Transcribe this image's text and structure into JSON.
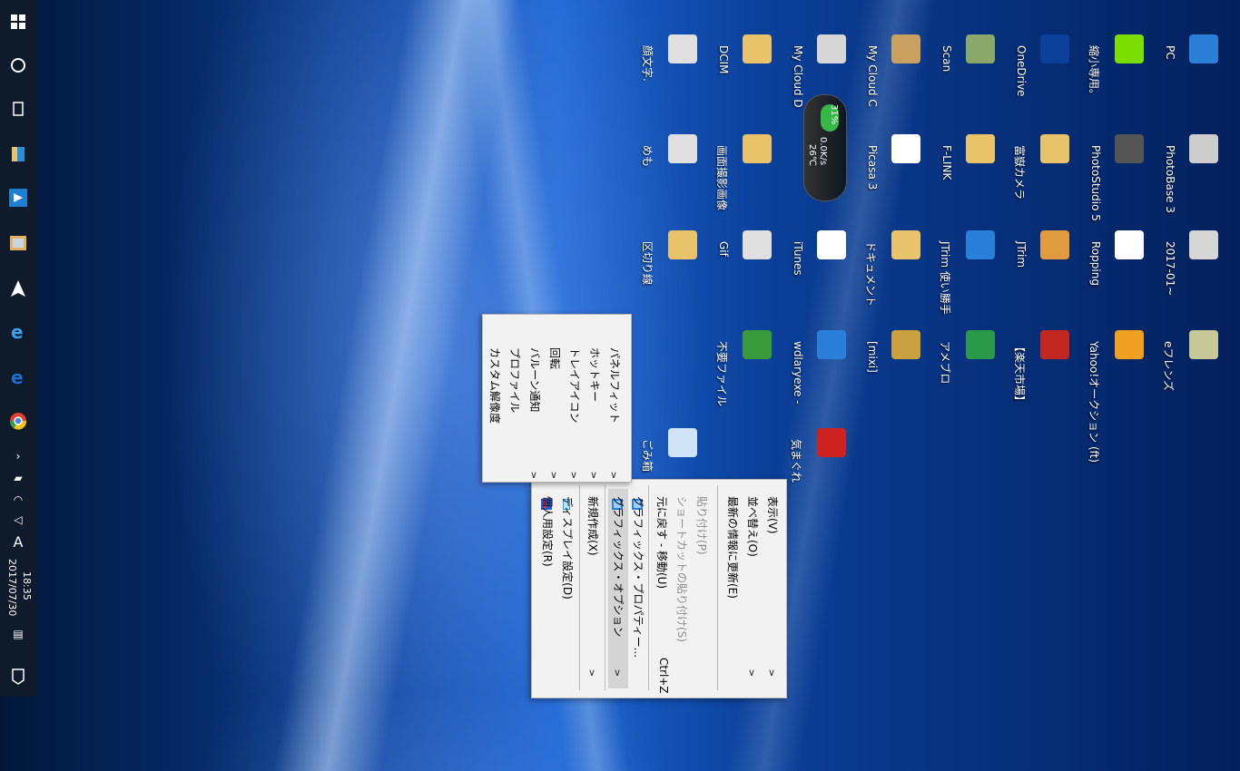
{
  "taskbar": {
    "clock_time": "18:35",
    "clock_date": "2017/07/30",
    "ime": "A"
  },
  "desktop_icons": [
    {
      "label": "PC",
      "icon": "pc-icon",
      "color": "#2a7fd8"
    },
    {
      "label": "PhotoBase 3",
      "icon": "photobase-icon",
      "color": "#cccccc"
    },
    {
      "label": "2017-01~",
      "icon": "spreadsheet-icon",
      "color": "#d6d6d6"
    },
    {
      "label": "eフレンズ",
      "icon": "efriends-icon",
      "color": "#c8c896"
    },
    {
      "label": "縮小専用。",
      "icon": "shrink-icon",
      "color": "#7cdd00"
    },
    {
      "label": "PhotoStudio 5",
      "icon": "photostudio-icon",
      "color": "#555555"
    },
    {
      "label": "Ropping",
      "icon": "ropping-icon",
      "color": "#ffffff"
    },
    {
      "label": "Yahoo!オークション (ft)",
      "icon": "yahoo-auction-icon",
      "color": "#f0a020"
    },
    {
      "label": "OneDrive",
      "icon": "onedrive-icon",
      "color": "#0a3f9a"
    },
    {
      "label": "富嶽カメラ",
      "icon": "folder-icon",
      "color": "#e9c36a"
    },
    {
      "label": "JTrim",
      "icon": "jtrim-icon",
      "color": "#e09a40"
    },
    {
      "label": "【楽天市場】",
      "icon": "rakuten-icon",
      "color": "#c0271e"
    },
    {
      "label": "Scan",
      "icon": "scan-icon",
      "color": "#8aa86a"
    },
    {
      "label": "F-LINK",
      "icon": "folder-icon",
      "color": "#e9c36a"
    },
    {
      "label": "JTrim 使い勝手",
      "icon": "ie-icon",
      "color": "#2a7fd8"
    },
    {
      "label": "アメブロ",
      "icon": "ameblo-icon",
      "color": "#2a9a4a"
    },
    {
      "label": "My Cloud C",
      "icon": "folder-photo-icon",
      "color": "#c8a060"
    },
    {
      "label": "Picasa 3",
      "icon": "picasa-icon",
      "color": "#ffffff"
    },
    {
      "label": "ドキュメント",
      "icon": "documents-icon",
      "color": "#e9c36a"
    },
    {
      "label": "[mixi]",
      "icon": "mixi-icon",
      "color": "#c8a040"
    },
    {
      "label": "My Cloud D",
      "icon": "folder-doc-icon",
      "color": "#d6d6d6"
    },
    {
      "label": "iTunes",
      "icon": "itunes-icon",
      "color": "#ffffff"
    },
    {
      "label": "wdlaryexe -",
      "icon": "wd-icon",
      "color": "#2a7fd8"
    },
    {
      "label": "気まぐれ",
      "icon": "kimagure-icon",
      "color": "#cc2222"
    },
    {
      "label": "DCIM",
      "icon": "folder-icon",
      "color": "#e9c36a"
    },
    {
      "label": "画面撮影画像",
      "icon": "folder-icon",
      "color": "#e9c36a"
    },
    {
      "label": "Gif",
      "icon": "gif-icon",
      "color": "#e0e0e0"
    },
    {
      "label": "不要ファイル",
      "icon": "recycle-green-icon",
      "color": "#3a9a3a"
    },
    {
      "label": "顔文字.",
      "icon": "doc-icon",
      "color": "#e0e0e0"
    },
    {
      "label": "めも",
      "icon": "memo-icon",
      "color": "#e0e0e0"
    },
    {
      "label": "区切り線",
      "icon": "folder-icon",
      "color": "#e9c36a"
    },
    {
      "label": "ごみ箱",
      "icon": "recycle-bin-icon",
      "color": "#cfe3f5"
    }
  ],
  "gadget": {
    "percent": "31%",
    "speed": "0.0K/s",
    "temp": "26℃"
  },
  "context_menu": {
    "items": [
      {
        "label": "表示(V)",
        "submenu": true
      },
      {
        "label": "並べ替え(O)",
        "submenu": true
      },
      {
        "label": "最新の情報に更新(E)"
      },
      {
        "label": "貼り付け(P)",
        "disabled": true
      },
      {
        "label": "ショートカットの貼り付け(S)",
        "disabled": true
      },
      {
        "label": "元に戻す - 移動(U)",
        "shortcut": "Ctrl+Z"
      },
      {
        "label": "グラフィックス・プロパティー...",
        "icon": true
      },
      {
        "label": "グラフィックス・オプション",
        "icon": true,
        "submenu": true,
        "highlighted": true
      },
      {
        "label": "新規作成(X)",
        "submenu": true
      },
      {
        "label": "ディスプレイ設定(D)",
        "icon": true
      },
      {
        "label": "個人用設定(R)",
        "icon": true
      }
    ]
  },
  "submenu": {
    "items": [
      {
        "label": "パネルフィット"
      },
      {
        "label": "ホットキー"
      },
      {
        "label": "トレイアイコン"
      },
      {
        "label": "回転"
      },
      {
        "label": "バルーン通知"
      },
      {
        "label": "プロファイル"
      },
      {
        "label": "カスタム解像度"
      }
    ]
  }
}
